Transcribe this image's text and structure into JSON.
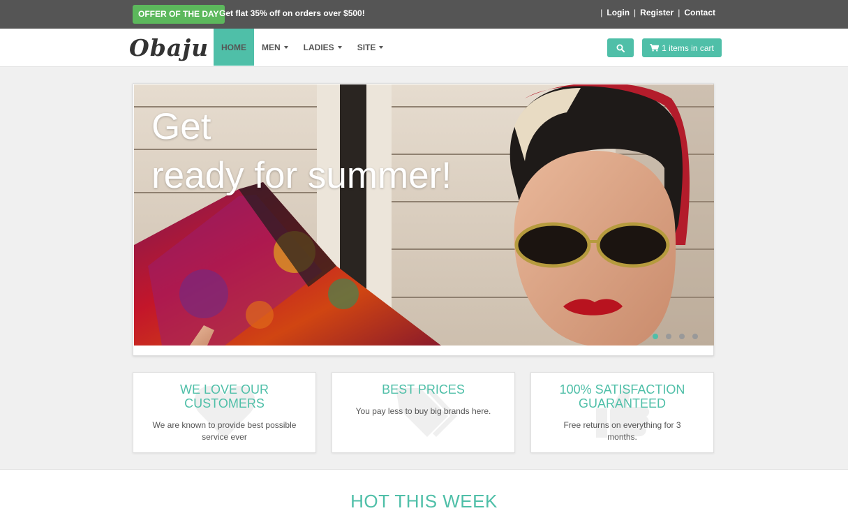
{
  "topbar": {
    "offer_badge": "OFFER OF THE DAY",
    "offer_text": "Get flat 35% off on orders over $500!",
    "links": [
      "Login",
      "Register",
      "Contact"
    ]
  },
  "navbar": {
    "logo": "Obaju",
    "items": [
      {
        "label": "HOME",
        "active": true
      },
      {
        "label": "MEN",
        "dropdown": true
      },
      {
        "label": "LADIES",
        "dropdown": true
      },
      {
        "label": "SITE",
        "dropdown": true
      }
    ],
    "search_icon": "search-icon",
    "cart_label": "1 items in cart",
    "cart_icon": "shopping-cart-icon"
  },
  "slider": {
    "headline_line1": "Get",
    "headline_line2": "ready for summer!",
    "dot_count": 4,
    "active_dot": 1
  },
  "features": [
    {
      "title": "WE LOVE OUR CUSTOMERS",
      "text": "We are known to provide best possible service ever",
      "icon": "heart-icon"
    },
    {
      "title": "BEST PRICES",
      "text": "You pay less to buy big brands here.",
      "icon": "tags-icon"
    },
    {
      "title": "100% SATISFACTION GUARANTEED",
      "text": "Free returns on everything for 3 months.",
      "icon": "thumbs-up-icon"
    }
  ],
  "hot": {
    "title": "HOT THIS WEEK"
  },
  "colors": {
    "accent": "#4fbfa8",
    "offer_green": "#5cb85c",
    "topbar": "#555555"
  }
}
